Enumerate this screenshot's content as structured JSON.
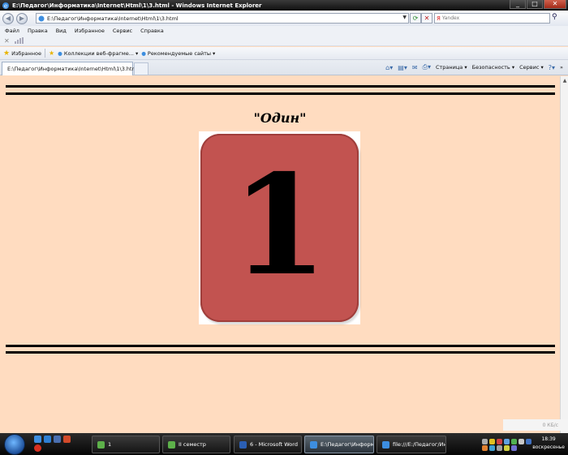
{
  "window": {
    "title": "E:\\Педагог\\Информатика\\Internet\\Html\\1\\3.html - Windows Internet Explorer",
    "controls": {
      "minimize": "_",
      "maximize": "□",
      "close": "✕"
    }
  },
  "address_bar": {
    "url": "E:\\Педагог\\Информатика\\Internet\\Html\\1\\3.html",
    "search_placeholder": "Yandex"
  },
  "menu": {
    "items": [
      "Файл",
      "Правка",
      "Вид",
      "Избранное",
      "Сервис",
      "Справка"
    ]
  },
  "favorites_bar": {
    "favorites_label": "Избранное",
    "web_slices_label": "Коллекции веб-фрагме...",
    "suggested_sites_label": "Рекомендуемые сайты"
  },
  "tab": {
    "label": "E:\\Педагог\\Информатика\\Internet\\Html\\1\\3.html"
  },
  "command_bar": {
    "page_label": "Страница",
    "safety_label": "Безопасность",
    "tools_label": "Сервис"
  },
  "page": {
    "heading": "\"Один\"",
    "tile_number": "1",
    "tile_color": "#c25350"
  },
  "status": {
    "net_rate": "0 КБ/с"
  },
  "taskbar": {
    "tasks": [
      {
        "label": "1"
      },
      {
        "label": "II семестр"
      },
      {
        "label": "6 - Microsoft Word"
      },
      {
        "label": "E:\\Педагог\\Информа..."
      },
      {
        "label": "file:///E:/Педагог/Ин..."
      }
    ],
    "clock_time": "18:39",
    "clock_day": "воскресенье"
  }
}
